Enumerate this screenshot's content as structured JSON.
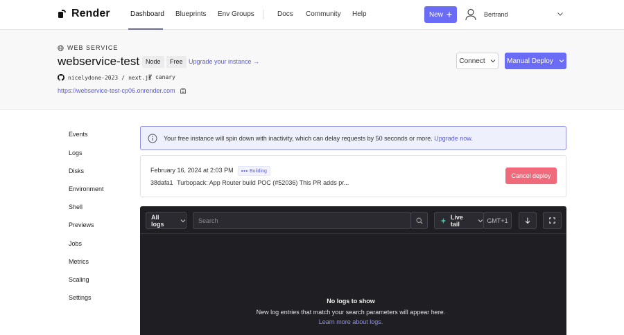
{
  "nav": {
    "brand": "Render",
    "links": [
      "Dashboard",
      "Blueprints",
      "Env Groups",
      "Docs",
      "Community",
      "Help"
    ],
    "new_label": "New",
    "user": "Bertrand"
  },
  "service": {
    "type": "WEB SERVICE",
    "name": "webservice-test",
    "tags": [
      "Node",
      "Free"
    ],
    "upgrade": "Upgrade your instance →",
    "repo_owner": "nicelydone-2023",
    "repo_sep": "/",
    "repo_name": "next.js",
    "branch": "canary",
    "url": "https://webservice-test-cp06.onrender.com",
    "connect": "Connect",
    "manual_deploy": "Manual Deploy"
  },
  "sidebar": {
    "items": [
      "Events",
      "Logs",
      "Disks",
      "Environment",
      "Shell",
      "Previews",
      "Jobs",
      "Metrics",
      "Scaling",
      "Settings"
    ]
  },
  "banner": {
    "text": "Your free instance will spin down with inactivity, which can delay requests by 50 seconds or more.",
    "link": "Upgrade now."
  },
  "deploy": {
    "date": "February 16, 2024 at 2:03 PM",
    "status": "Building",
    "commit_hash": "38dafa1",
    "commit_msg": "Turbopack: App Router build POC (#52036) This PR adds pr...",
    "cancel": "Cancel deploy"
  },
  "logs": {
    "filter": "All logs",
    "search_placeholder": "Search",
    "live_tail": "Live tail",
    "timezone": "GMT+1",
    "empty_title": "No logs to show",
    "empty_sub": "New log entries that match your search parameters will appear here.",
    "empty_link": "Learn more about logs."
  },
  "colors": {
    "accent": "#6b6cf6",
    "danger": "#f06a7c",
    "log_bg": "#1f1f23"
  }
}
